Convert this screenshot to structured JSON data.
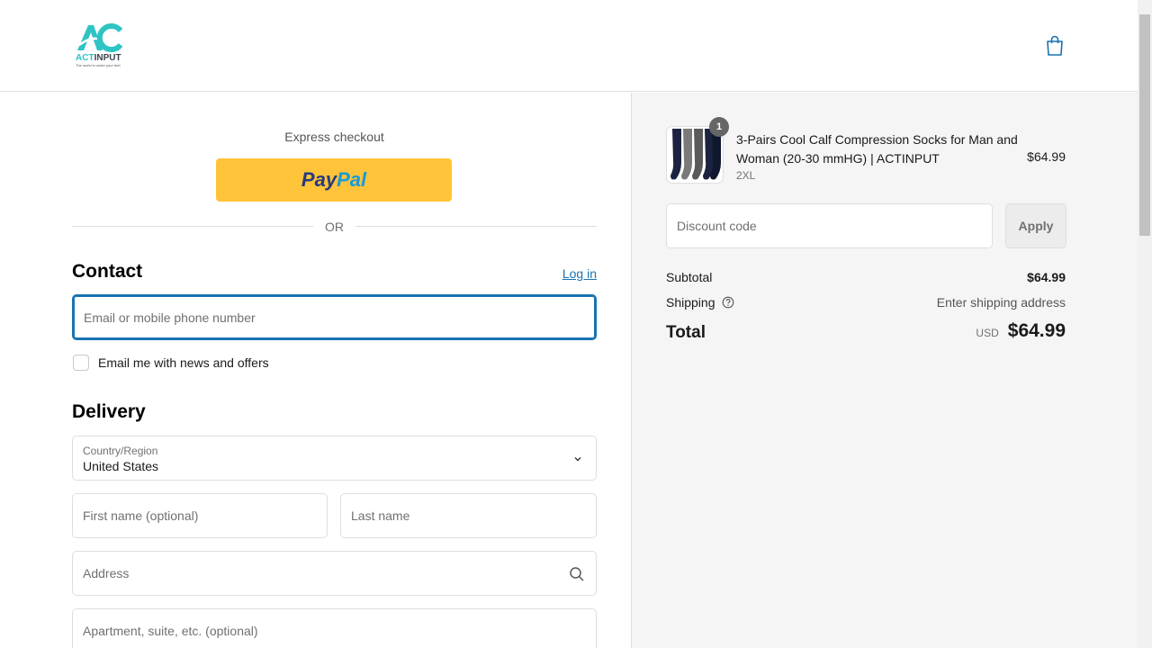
{
  "header": {
    "logo_brand_a": "ACT",
    "logo_brand_b": "INPUT",
    "logo_tagline": "The world is under your feet",
    "cart_icon": "shopping-bag-icon"
  },
  "colors": {
    "accent": "#1773b0",
    "paypal_yellow": "#ffc439",
    "logo_teal": "#2ec4c4"
  },
  "express": {
    "title": "Express checkout",
    "paypal_a": "Pay",
    "paypal_b": "Pal",
    "or": "OR"
  },
  "contact": {
    "heading": "Contact",
    "login": "Log in",
    "email_placeholder": "Email or mobile phone number",
    "newsletter_label": "Email me with news and offers"
  },
  "delivery": {
    "heading": "Delivery",
    "country_label": "Country/Region",
    "country_value": "United States",
    "first_name_placeholder": "First name (optional)",
    "last_name_placeholder": "Last name",
    "address_placeholder": "Address",
    "apartment_placeholder": "Apartment, suite, etc. (optional)"
  },
  "summary": {
    "product": {
      "quantity": "1",
      "title": "3-Pairs Cool Calf Compression Socks for Man and Woman (20-30 mmHG)  | ACTINPUT",
      "variant": "2XL",
      "price": "$64.99"
    },
    "discount_placeholder": "Discount code",
    "apply_label": "Apply",
    "subtotal_label": "Subtotal",
    "subtotal_value": "$64.99",
    "shipping_label": "Shipping",
    "shipping_value": "Enter shipping address",
    "total_label": "Total",
    "total_currency": "USD",
    "total_value": "$64.99"
  }
}
